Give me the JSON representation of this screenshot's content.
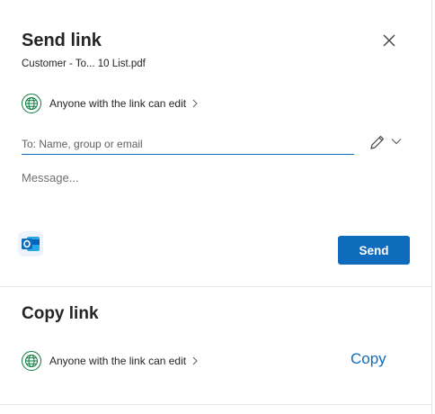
{
  "send": {
    "title": "Send link",
    "file_name": "Customer - To... 10 List.pdf",
    "permission": "Anyone with the link can edit",
    "to_placeholder": "To: Name, group or email",
    "message_placeholder": "Message...",
    "send_label": "Send"
  },
  "copy": {
    "title": "Copy link",
    "permission": "Anyone with the link can edit",
    "copy_label": "Copy"
  },
  "colors": {
    "accent": "#0f6cbd",
    "globe": "#0b7a3e"
  },
  "icons": [
    "close-icon",
    "globe-icon",
    "chevron-right-icon",
    "pencil-icon",
    "chevron-down-icon",
    "outlook-icon"
  ]
}
